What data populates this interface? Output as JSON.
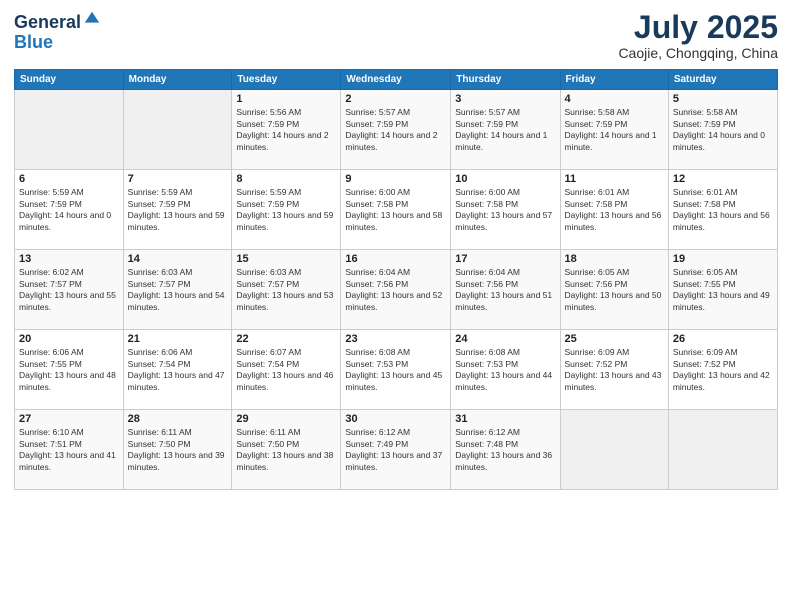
{
  "header": {
    "logo_line1": "General",
    "logo_line2": "Blue",
    "month_title": "July 2025",
    "location": "Caojie, Chongqing, China"
  },
  "weekdays": [
    "Sunday",
    "Monday",
    "Tuesday",
    "Wednesday",
    "Thursday",
    "Friday",
    "Saturday"
  ],
  "weeks": [
    [
      {
        "day": "",
        "sunrise": "",
        "sunset": "",
        "daylight": ""
      },
      {
        "day": "",
        "sunrise": "",
        "sunset": "",
        "daylight": ""
      },
      {
        "day": "1",
        "sunrise": "Sunrise: 5:56 AM",
        "sunset": "Sunset: 7:59 PM",
        "daylight": "Daylight: 14 hours and 2 minutes."
      },
      {
        "day": "2",
        "sunrise": "Sunrise: 5:57 AM",
        "sunset": "Sunset: 7:59 PM",
        "daylight": "Daylight: 14 hours and 2 minutes."
      },
      {
        "day": "3",
        "sunrise": "Sunrise: 5:57 AM",
        "sunset": "Sunset: 7:59 PM",
        "daylight": "Daylight: 14 hours and 1 minute."
      },
      {
        "day": "4",
        "sunrise": "Sunrise: 5:58 AM",
        "sunset": "Sunset: 7:59 PM",
        "daylight": "Daylight: 14 hours and 1 minute."
      },
      {
        "day": "5",
        "sunrise": "Sunrise: 5:58 AM",
        "sunset": "Sunset: 7:59 PM",
        "daylight": "Daylight: 14 hours and 0 minutes."
      }
    ],
    [
      {
        "day": "6",
        "sunrise": "Sunrise: 5:59 AM",
        "sunset": "Sunset: 7:59 PM",
        "daylight": "Daylight: 14 hours and 0 minutes."
      },
      {
        "day": "7",
        "sunrise": "Sunrise: 5:59 AM",
        "sunset": "Sunset: 7:59 PM",
        "daylight": "Daylight: 13 hours and 59 minutes."
      },
      {
        "day": "8",
        "sunrise": "Sunrise: 5:59 AM",
        "sunset": "Sunset: 7:59 PM",
        "daylight": "Daylight: 13 hours and 59 minutes."
      },
      {
        "day": "9",
        "sunrise": "Sunrise: 6:00 AM",
        "sunset": "Sunset: 7:58 PM",
        "daylight": "Daylight: 13 hours and 58 minutes."
      },
      {
        "day": "10",
        "sunrise": "Sunrise: 6:00 AM",
        "sunset": "Sunset: 7:58 PM",
        "daylight": "Daylight: 13 hours and 57 minutes."
      },
      {
        "day": "11",
        "sunrise": "Sunrise: 6:01 AM",
        "sunset": "Sunset: 7:58 PM",
        "daylight": "Daylight: 13 hours and 56 minutes."
      },
      {
        "day": "12",
        "sunrise": "Sunrise: 6:01 AM",
        "sunset": "Sunset: 7:58 PM",
        "daylight": "Daylight: 13 hours and 56 minutes."
      }
    ],
    [
      {
        "day": "13",
        "sunrise": "Sunrise: 6:02 AM",
        "sunset": "Sunset: 7:57 PM",
        "daylight": "Daylight: 13 hours and 55 minutes."
      },
      {
        "day": "14",
        "sunrise": "Sunrise: 6:03 AM",
        "sunset": "Sunset: 7:57 PM",
        "daylight": "Daylight: 13 hours and 54 minutes."
      },
      {
        "day": "15",
        "sunrise": "Sunrise: 6:03 AM",
        "sunset": "Sunset: 7:57 PM",
        "daylight": "Daylight: 13 hours and 53 minutes."
      },
      {
        "day": "16",
        "sunrise": "Sunrise: 6:04 AM",
        "sunset": "Sunset: 7:56 PM",
        "daylight": "Daylight: 13 hours and 52 minutes."
      },
      {
        "day": "17",
        "sunrise": "Sunrise: 6:04 AM",
        "sunset": "Sunset: 7:56 PM",
        "daylight": "Daylight: 13 hours and 51 minutes."
      },
      {
        "day": "18",
        "sunrise": "Sunrise: 6:05 AM",
        "sunset": "Sunset: 7:56 PM",
        "daylight": "Daylight: 13 hours and 50 minutes."
      },
      {
        "day": "19",
        "sunrise": "Sunrise: 6:05 AM",
        "sunset": "Sunset: 7:55 PM",
        "daylight": "Daylight: 13 hours and 49 minutes."
      }
    ],
    [
      {
        "day": "20",
        "sunrise": "Sunrise: 6:06 AM",
        "sunset": "Sunset: 7:55 PM",
        "daylight": "Daylight: 13 hours and 48 minutes."
      },
      {
        "day": "21",
        "sunrise": "Sunrise: 6:06 AM",
        "sunset": "Sunset: 7:54 PM",
        "daylight": "Daylight: 13 hours and 47 minutes."
      },
      {
        "day": "22",
        "sunrise": "Sunrise: 6:07 AM",
        "sunset": "Sunset: 7:54 PM",
        "daylight": "Daylight: 13 hours and 46 minutes."
      },
      {
        "day": "23",
        "sunrise": "Sunrise: 6:08 AM",
        "sunset": "Sunset: 7:53 PM",
        "daylight": "Daylight: 13 hours and 45 minutes."
      },
      {
        "day": "24",
        "sunrise": "Sunrise: 6:08 AM",
        "sunset": "Sunset: 7:53 PM",
        "daylight": "Daylight: 13 hours and 44 minutes."
      },
      {
        "day": "25",
        "sunrise": "Sunrise: 6:09 AM",
        "sunset": "Sunset: 7:52 PM",
        "daylight": "Daylight: 13 hours and 43 minutes."
      },
      {
        "day": "26",
        "sunrise": "Sunrise: 6:09 AM",
        "sunset": "Sunset: 7:52 PM",
        "daylight": "Daylight: 13 hours and 42 minutes."
      }
    ],
    [
      {
        "day": "27",
        "sunrise": "Sunrise: 6:10 AM",
        "sunset": "Sunset: 7:51 PM",
        "daylight": "Daylight: 13 hours and 41 minutes."
      },
      {
        "day": "28",
        "sunrise": "Sunrise: 6:11 AM",
        "sunset": "Sunset: 7:50 PM",
        "daylight": "Daylight: 13 hours and 39 minutes."
      },
      {
        "day": "29",
        "sunrise": "Sunrise: 6:11 AM",
        "sunset": "Sunset: 7:50 PM",
        "daylight": "Daylight: 13 hours and 38 minutes."
      },
      {
        "day": "30",
        "sunrise": "Sunrise: 6:12 AM",
        "sunset": "Sunset: 7:49 PM",
        "daylight": "Daylight: 13 hours and 37 minutes."
      },
      {
        "day": "31",
        "sunrise": "Sunrise: 6:12 AM",
        "sunset": "Sunset: 7:48 PM",
        "daylight": "Daylight: 13 hours and 36 minutes."
      },
      {
        "day": "",
        "sunrise": "",
        "sunset": "",
        "daylight": ""
      },
      {
        "day": "",
        "sunrise": "",
        "sunset": "",
        "daylight": ""
      }
    ]
  ]
}
